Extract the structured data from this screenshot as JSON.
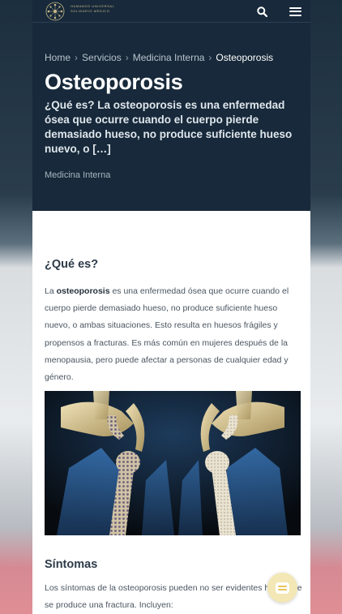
{
  "header": {
    "logo_text_line1": "HUMANOS UNIVERSAL",
    "logo_text_line2": "SOLIDARIO MEDICO",
    "search_icon": "search-icon",
    "menu_icon": "hamburger-menu-icon"
  },
  "breadcrumb": {
    "items": [
      "Home",
      "Servicios",
      "Medicina Interna"
    ],
    "separator": "›",
    "current": "Osteoporosis"
  },
  "hero": {
    "title": "Osteoporosis",
    "summary": "¿Qué es? La osteoporosis  es una enfermedad ósea que ocurre cuando el cuerpo pierde demasiado hueso, no produce suficiente hueso nuevo, o […]",
    "category": "Medicina Interna"
  },
  "article": {
    "section1_heading": "¿Qué es?",
    "section1_bold": "osteoporosis",
    "section1_lead": "La ",
    "section1_text": " es una enfermedad ósea que ocurre cuando el cuerpo pierde demasiado hueso, no produce suficiente hueso nuevo, o ambas situaciones. Esto resulta en huesos frágiles y propensos a fracturas. Es más común en mujeres después de la menopausia, pero puede afectar a personas de cualquier edad y género.",
    "section2_heading": "Síntomas",
    "section2_text": "Los síntomas de la osteoporosis pueden no ser evidentes hasta que se produce una fractura. Incluyen:"
  },
  "chat": {
    "icon": "chat-bubble-icon"
  },
  "colors": {
    "hero_bg": "#17293a",
    "accent_gold": "#c9b98a",
    "chat_bg": "#f3e7b6"
  }
}
